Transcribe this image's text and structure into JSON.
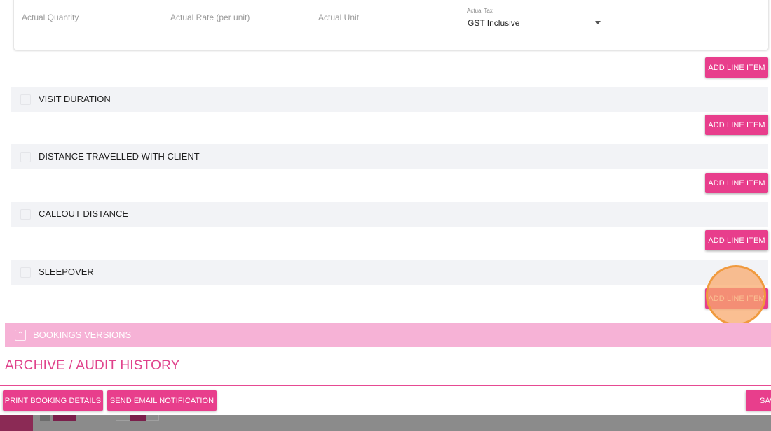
{
  "actuals": {
    "quantity_placeholder": "Actual Quantity",
    "rate_placeholder": "Actual Rate (per unit)",
    "unit_placeholder": "Actual Unit",
    "tax_label": "Actual Tax",
    "tax_value": "GST Inclusive"
  },
  "add_line_item_label": "ADD LINE ITEM",
  "sections": [
    {
      "title": "VISIT DURATION"
    },
    {
      "title": "DISTANCE TRAVELLED WITH CLIENT"
    },
    {
      "title": "CALLOUT DISTANCE"
    },
    {
      "title": "SLEEPOVER"
    }
  ],
  "bookings_versions": {
    "title": "BOOKINGS VERSIONS"
  },
  "audit": {
    "title": "ARCHIVE / AUDIT HISTORY"
  },
  "footer": {
    "print_label": "PRINT BOOKING DETAILS",
    "email_label": "SEND EMAIL NOTIFICATION",
    "save_label": "SAV"
  },
  "colors": {
    "accent": "#e83e8c",
    "versions_bar": "#f6b2d6",
    "section_bg": "#f2f3f6",
    "click_highlight": "#f09a3e"
  },
  "icons": {
    "tax_dropdown": "caret-down-icon",
    "section_checkbox": "checkbox-icon",
    "versions_toggle": "chevron-up-icon"
  }
}
